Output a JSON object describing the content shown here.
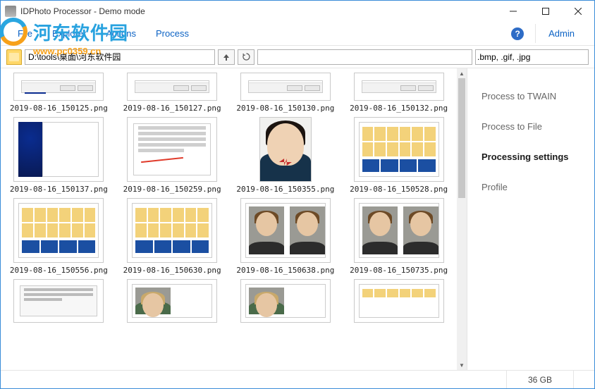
{
  "window": {
    "title": "IDPhoto Processor - Demo mode"
  },
  "menu": {
    "file": "File",
    "explorer": "Explorer",
    "actions": "Actions",
    "process": "Process",
    "admin": "Admin"
  },
  "watermark": {
    "brand": "河东软件园",
    "url": "www.pc0359.cn"
  },
  "toolbar": {
    "path": "D:\\tools\\桌面\\河东软件园",
    "search": "",
    "extensions": ".bmp, .gif, .jpg"
  },
  "sidebar": {
    "items": [
      {
        "label": "Process to TWAIN"
      },
      {
        "label": "Process to File"
      },
      {
        "label": "Processing settings"
      },
      {
        "label": "Profile"
      }
    ]
  },
  "files": [
    {
      "name": "2019-08-16_150125.png"
    },
    {
      "name": "2019-08-16_150127.png"
    },
    {
      "name": "2019-08-16_150130.png"
    },
    {
      "name": "2019-08-16_150132.png"
    },
    {
      "name": "2019-08-16_150137.png"
    },
    {
      "name": "2019-08-16_150259.png"
    },
    {
      "name": "2019-08-16_150355.png"
    },
    {
      "name": "2019-08-16_150528.png"
    },
    {
      "name": "2019-08-16_150556.png"
    },
    {
      "name": "2019-08-16_150630.png"
    },
    {
      "name": "2019-08-16_150638.png"
    },
    {
      "name": "2019-08-16_150735.png"
    },
    {
      "name": ""
    },
    {
      "name": ""
    },
    {
      "name": ""
    },
    {
      "name": ""
    }
  ],
  "status": {
    "disk": "36 GB"
  }
}
